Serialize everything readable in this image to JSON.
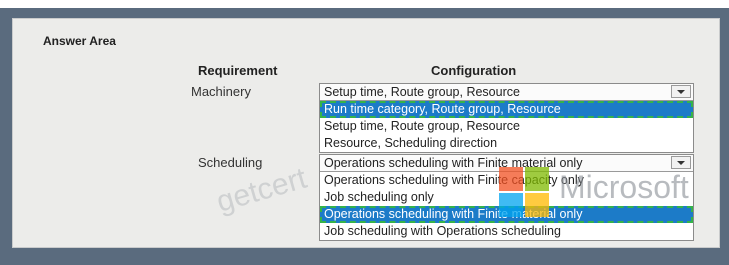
{
  "answer_area_title": "Answer Area",
  "headers": {
    "requirement": "Requirement",
    "configuration": "Configuration"
  },
  "rows": [
    {
      "label": "Machinery",
      "selected": "Setup time, Route group, Resource",
      "options": [
        "Run time category, Route group, Resource",
        "Setup time, Route group, Resource",
        "Resource, Scheduling direction"
      ],
      "highlighted_index": 0
    },
    {
      "label": "Scheduling",
      "selected": "Operations scheduling with Finite material only",
      "options": [
        "Operations scheduling with Finite capacity only",
        "Job scheduling only",
        "Operations scheduling with Finite material only",
        "Job scheduling with Operations scheduling"
      ],
      "highlighted_index": 2
    }
  ],
  "watermark": {
    "site": "getcert",
    "brand": "Microsoft"
  },
  "colors": {
    "highlight": "#1c7bc8",
    "dash": "#35b34a"
  }
}
